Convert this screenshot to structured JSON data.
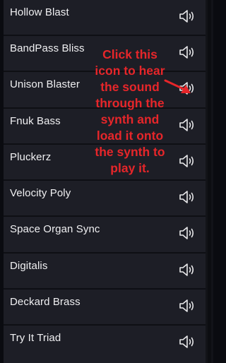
{
  "presets": [
    {
      "name": "Hollow Blast",
      "icon": "speaker-icon"
    },
    {
      "name": "BandPass Bliss",
      "icon": "speaker-icon"
    },
    {
      "name": "Unison Blaster",
      "icon": "speaker-icon"
    },
    {
      "name": "Fnuk Bass",
      "icon": "speaker-icon"
    },
    {
      "name": "Pluckerz",
      "icon": "speaker-icon"
    },
    {
      "name": "Velocity Poly",
      "icon": "speaker-icon"
    },
    {
      "name": "Space Organ Sync",
      "icon": "speaker-icon"
    },
    {
      "name": "Digitalis",
      "icon": "speaker-icon"
    },
    {
      "name": "Deckard Brass",
      "icon": "speaker-icon"
    },
    {
      "name": "Try It Triad",
      "icon": "speaker-icon"
    }
  ],
  "annotation": {
    "text": "Click this\nicon to hear\nthe sound\nthrough the\nsynth and\nload it onto\nthe synth to\nplay it.",
    "color": "#e6262a"
  },
  "colors": {
    "row_bg": "#1d1e26",
    "row_border": "#0e0f14",
    "text": "#f0f0f2",
    "icon": "#e8e8ea"
  }
}
